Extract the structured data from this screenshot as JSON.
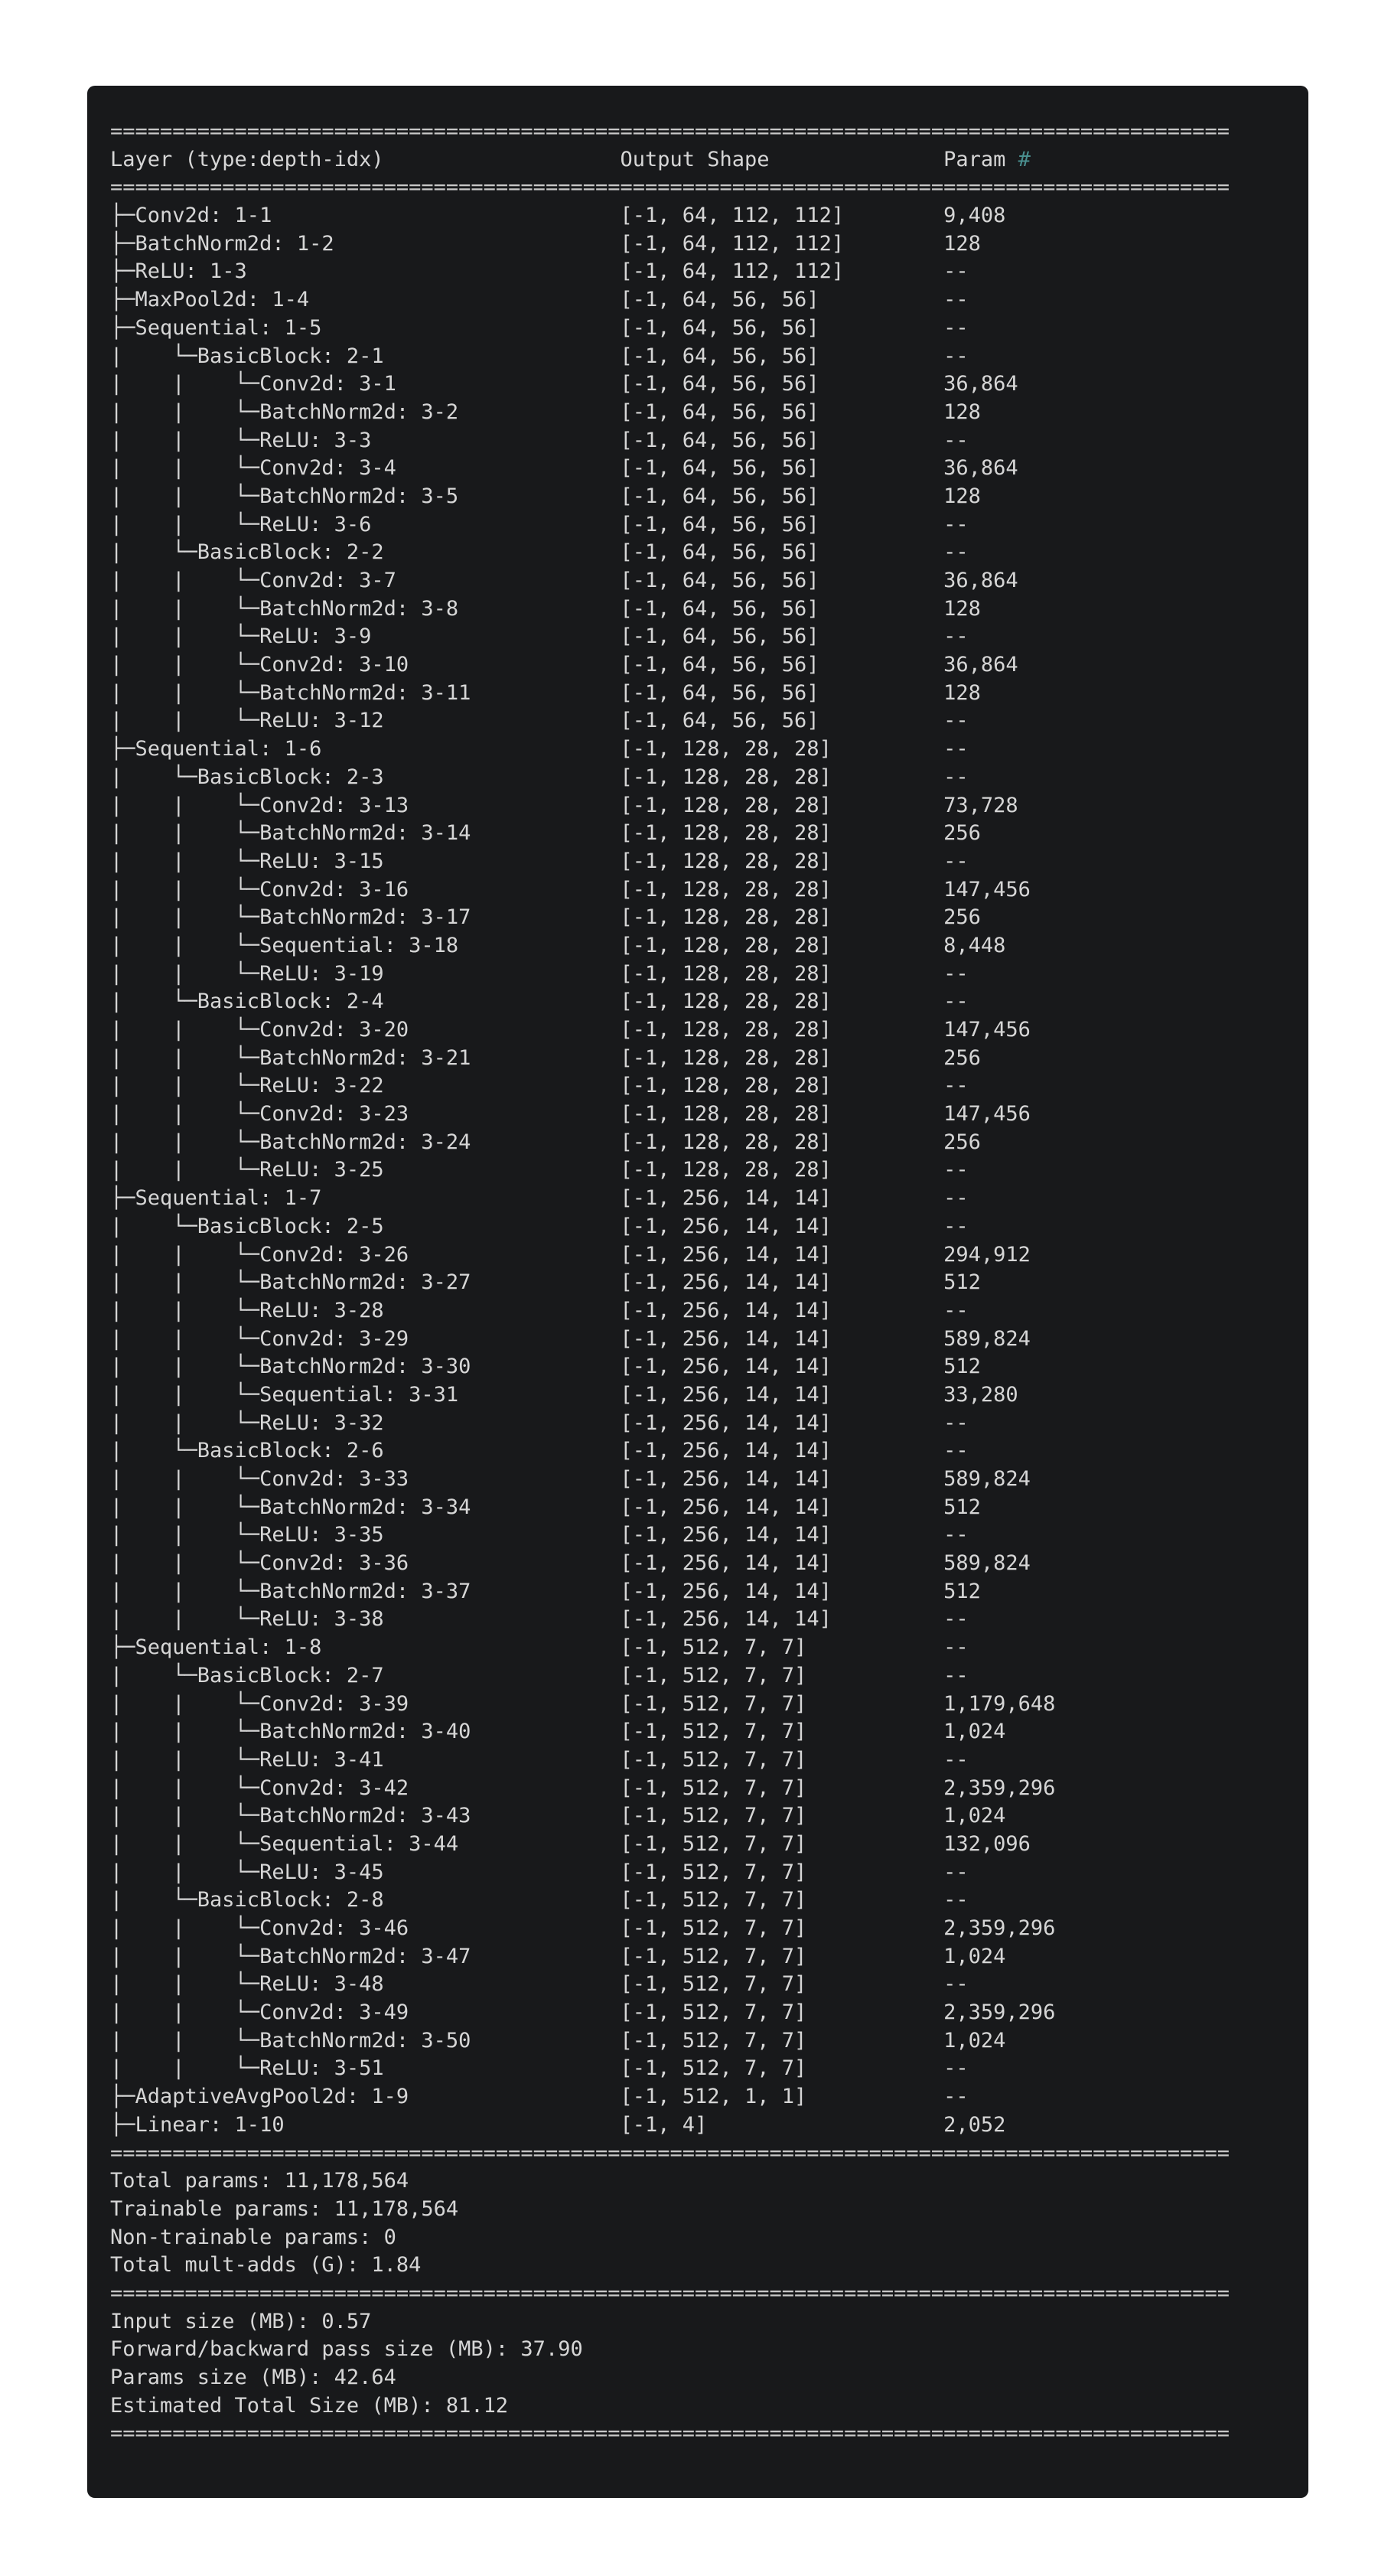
{
  "separator": "==========================================================================================",
  "header": {
    "layer": "Layer (type:depth-idx)",
    "output": "Output Shape",
    "param": "Param",
    "param_hash": "#"
  },
  "rows": [
    [
      "├─Conv2d: 1-1",
      "[-1, 64, 112, 112]",
      "9,408"
    ],
    [
      "├─BatchNorm2d: 1-2",
      "[-1, 64, 112, 112]",
      "128"
    ],
    [
      "├─ReLU: 1-3",
      "[-1, 64, 112, 112]",
      "--"
    ],
    [
      "├─MaxPool2d: 1-4",
      "[-1, 64, 56, 56]",
      "--"
    ],
    [
      "├─Sequential: 1-5",
      "[-1, 64, 56, 56]",
      "--"
    ],
    [
      "|    └─BasicBlock: 2-1",
      "[-1, 64, 56, 56]",
      "--"
    ],
    [
      "|    |    └─Conv2d: 3-1",
      "[-1, 64, 56, 56]",
      "36,864"
    ],
    [
      "|    |    └─BatchNorm2d: 3-2",
      "[-1, 64, 56, 56]",
      "128"
    ],
    [
      "|    |    └─ReLU: 3-3",
      "[-1, 64, 56, 56]",
      "--"
    ],
    [
      "|    |    └─Conv2d: 3-4",
      "[-1, 64, 56, 56]",
      "36,864"
    ],
    [
      "|    |    └─BatchNorm2d: 3-5",
      "[-1, 64, 56, 56]",
      "128"
    ],
    [
      "|    |    └─ReLU: 3-6",
      "[-1, 64, 56, 56]",
      "--"
    ],
    [
      "|    └─BasicBlock: 2-2",
      "[-1, 64, 56, 56]",
      "--"
    ],
    [
      "|    |    └─Conv2d: 3-7",
      "[-1, 64, 56, 56]",
      "36,864"
    ],
    [
      "|    |    └─BatchNorm2d: 3-8",
      "[-1, 64, 56, 56]",
      "128"
    ],
    [
      "|    |    └─ReLU: 3-9",
      "[-1, 64, 56, 56]",
      "--"
    ],
    [
      "|    |    └─Conv2d: 3-10",
      "[-1, 64, 56, 56]",
      "36,864"
    ],
    [
      "|    |    └─BatchNorm2d: 3-11",
      "[-1, 64, 56, 56]",
      "128"
    ],
    [
      "|    |    └─ReLU: 3-12",
      "[-1, 64, 56, 56]",
      "--"
    ],
    [
      "├─Sequential: 1-6",
      "[-1, 128, 28, 28]",
      "--"
    ],
    [
      "|    └─BasicBlock: 2-3",
      "[-1, 128, 28, 28]",
      "--"
    ],
    [
      "|    |    └─Conv2d: 3-13",
      "[-1, 128, 28, 28]",
      "73,728"
    ],
    [
      "|    |    └─BatchNorm2d: 3-14",
      "[-1, 128, 28, 28]",
      "256"
    ],
    [
      "|    |    └─ReLU: 3-15",
      "[-1, 128, 28, 28]",
      "--"
    ],
    [
      "|    |    └─Conv2d: 3-16",
      "[-1, 128, 28, 28]",
      "147,456"
    ],
    [
      "|    |    └─BatchNorm2d: 3-17",
      "[-1, 128, 28, 28]",
      "256"
    ],
    [
      "|    |    └─Sequential: 3-18",
      "[-1, 128, 28, 28]",
      "8,448"
    ],
    [
      "|    |    └─ReLU: 3-19",
      "[-1, 128, 28, 28]",
      "--"
    ],
    [
      "|    └─BasicBlock: 2-4",
      "[-1, 128, 28, 28]",
      "--"
    ],
    [
      "|    |    └─Conv2d: 3-20",
      "[-1, 128, 28, 28]",
      "147,456"
    ],
    [
      "|    |    └─BatchNorm2d: 3-21",
      "[-1, 128, 28, 28]",
      "256"
    ],
    [
      "|    |    └─ReLU: 3-22",
      "[-1, 128, 28, 28]",
      "--"
    ],
    [
      "|    |    └─Conv2d: 3-23",
      "[-1, 128, 28, 28]",
      "147,456"
    ],
    [
      "|    |    └─BatchNorm2d: 3-24",
      "[-1, 128, 28, 28]",
      "256"
    ],
    [
      "|    |    └─ReLU: 3-25",
      "[-1, 128, 28, 28]",
      "--"
    ],
    [
      "├─Sequential: 1-7",
      "[-1, 256, 14, 14]",
      "--"
    ],
    [
      "|    └─BasicBlock: 2-5",
      "[-1, 256, 14, 14]",
      "--"
    ],
    [
      "|    |    └─Conv2d: 3-26",
      "[-1, 256, 14, 14]",
      "294,912"
    ],
    [
      "|    |    └─BatchNorm2d: 3-27",
      "[-1, 256, 14, 14]",
      "512"
    ],
    [
      "|    |    └─ReLU: 3-28",
      "[-1, 256, 14, 14]",
      "--"
    ],
    [
      "|    |    └─Conv2d: 3-29",
      "[-1, 256, 14, 14]",
      "589,824"
    ],
    [
      "|    |    └─BatchNorm2d: 3-30",
      "[-1, 256, 14, 14]",
      "512"
    ],
    [
      "|    |    └─Sequential: 3-31",
      "[-1, 256, 14, 14]",
      "33,280"
    ],
    [
      "|    |    └─ReLU: 3-32",
      "[-1, 256, 14, 14]",
      "--"
    ],
    [
      "|    └─BasicBlock: 2-6",
      "[-1, 256, 14, 14]",
      "--"
    ],
    [
      "|    |    └─Conv2d: 3-33",
      "[-1, 256, 14, 14]",
      "589,824"
    ],
    [
      "|    |    └─BatchNorm2d: 3-34",
      "[-1, 256, 14, 14]",
      "512"
    ],
    [
      "|    |    └─ReLU: 3-35",
      "[-1, 256, 14, 14]",
      "--"
    ],
    [
      "|    |    └─Conv2d: 3-36",
      "[-1, 256, 14, 14]",
      "589,824"
    ],
    [
      "|    |    └─BatchNorm2d: 3-37",
      "[-1, 256, 14, 14]",
      "512"
    ],
    [
      "|    |    └─ReLU: 3-38",
      "[-1, 256, 14, 14]",
      "--"
    ],
    [
      "├─Sequential: 1-8",
      "[-1, 512, 7, 7]",
      "--"
    ],
    [
      "|    └─BasicBlock: 2-7",
      "[-1, 512, 7, 7]",
      "--"
    ],
    [
      "|    |    └─Conv2d: 3-39",
      "[-1, 512, 7, 7]",
      "1,179,648"
    ],
    [
      "|    |    └─BatchNorm2d: 3-40",
      "[-1, 512, 7, 7]",
      "1,024"
    ],
    [
      "|    |    └─ReLU: 3-41",
      "[-1, 512, 7, 7]",
      "--"
    ],
    [
      "|    |    └─Conv2d: 3-42",
      "[-1, 512, 7, 7]",
      "2,359,296"
    ],
    [
      "|    |    └─BatchNorm2d: 3-43",
      "[-1, 512, 7, 7]",
      "1,024"
    ],
    [
      "|    |    └─Sequential: 3-44",
      "[-1, 512, 7, 7]",
      "132,096"
    ],
    [
      "|    |    └─ReLU: 3-45",
      "[-1, 512, 7, 7]",
      "--"
    ],
    [
      "|    └─BasicBlock: 2-8",
      "[-1, 512, 7, 7]",
      "--"
    ],
    [
      "|    |    └─Conv2d: 3-46",
      "[-1, 512, 7, 7]",
      "2,359,296"
    ],
    [
      "|    |    └─BatchNorm2d: 3-47",
      "[-1, 512, 7, 7]",
      "1,024"
    ],
    [
      "|    |    └─ReLU: 3-48",
      "[-1, 512, 7, 7]",
      "--"
    ],
    [
      "|    |    └─Conv2d: 3-49",
      "[-1, 512, 7, 7]",
      "2,359,296"
    ],
    [
      "|    |    └─BatchNorm2d: 3-50",
      "[-1, 512, 7, 7]",
      "1,024"
    ],
    [
      "|    |    └─ReLU: 3-51",
      "[-1, 512, 7, 7]",
      "--"
    ],
    [
      "├─AdaptiveAvgPool2d: 1-9",
      "[-1, 512, 1, 1]",
      "--"
    ],
    [
      "├─Linear: 1-10",
      "[-1, 4]",
      "2,052"
    ]
  ],
  "totals": [
    "Total params: 11,178,564",
    "Trainable params: 11,178,564",
    "Non-trainable params: 0",
    "Total mult-adds (G): 1.84"
  ],
  "sizes": [
    "Input size (MB): 0.57",
    "Forward/backward pass size (MB): 37.90",
    "Params size (MB): 42.64",
    "Estimated Total Size (MB): 81.12"
  ],
  "colors": {
    "background": "#18191b",
    "text": "#d6d6d6",
    "hash": "#4a8f8f"
  }
}
